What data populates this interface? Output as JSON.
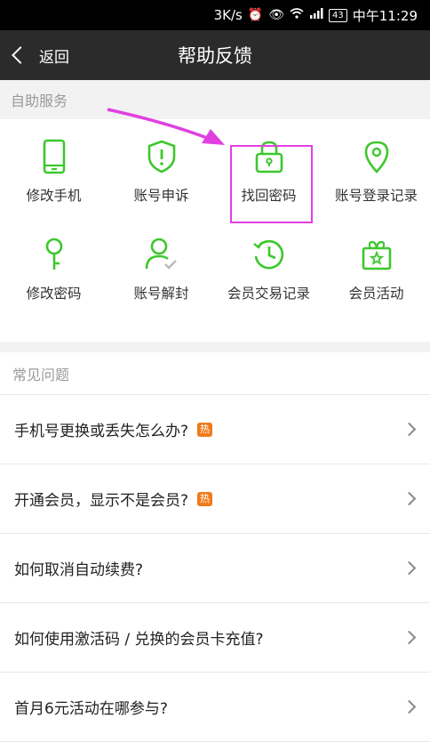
{
  "statusbar": {
    "speed": "3K/s",
    "battery": "43",
    "time": "中午11:29"
  },
  "navbar": {
    "back_label": "返回",
    "title": "帮助反馈"
  },
  "self_service": {
    "heading": "自助服务",
    "items": [
      {
        "label": "修改手机",
        "icon": "phone-icon"
      },
      {
        "label": "账号申诉",
        "icon": "shield-alert-icon"
      },
      {
        "label": "找回密码",
        "icon": "lock-icon"
      },
      {
        "label": "账号登录记录",
        "icon": "location-pin-icon"
      },
      {
        "label": "修改密码",
        "icon": "key-icon"
      },
      {
        "label": "账号解封",
        "icon": "user-check-icon"
      },
      {
        "label": "会员交易记录",
        "icon": "clock-refresh-icon"
      },
      {
        "label": "会员活动",
        "icon": "gift-icon"
      }
    ],
    "accent_color": "#3cc82d",
    "highlight_color": "#e040e0"
  },
  "faq": {
    "heading": "常见问题",
    "hot_label": "热",
    "items": [
      {
        "question": "手机号更换或丢失怎么办?",
        "hot": true
      },
      {
        "question": "开通会员，显示不是会员?",
        "hot": true
      },
      {
        "question": "如何取消自动续费?",
        "hot": false
      },
      {
        "question": "如何使用激活码 / 兑换的会员卡充值?",
        "hot": false
      },
      {
        "question": "首月6元活动在哪参与?",
        "hot": false
      }
    ]
  }
}
